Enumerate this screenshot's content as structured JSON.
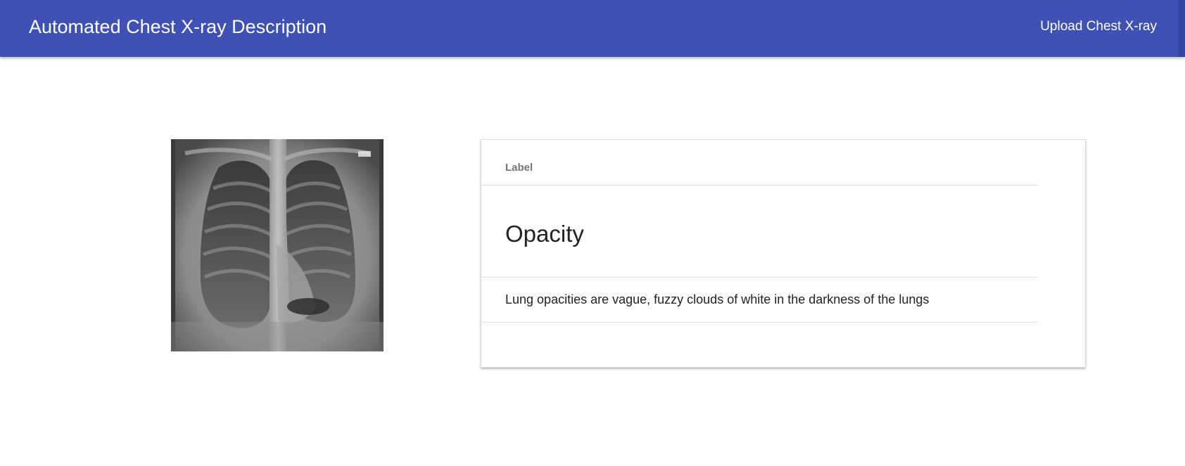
{
  "header": {
    "title": "Automated Chest X-ray Description",
    "upload_label": "Upload Chest X-ray"
  },
  "image": {
    "alt": "chest x-ray"
  },
  "result": {
    "column_header": "Label",
    "label": "Opacity",
    "description": "Lung opacities are vague, fuzzy clouds of white in the darkness of the lungs"
  },
  "colors": {
    "app_bar": "#3f51b5",
    "app_bar_text": "#ffffff",
    "header_text": "#757575",
    "body_text": "#212121",
    "divider": "#e0e0e0"
  }
}
